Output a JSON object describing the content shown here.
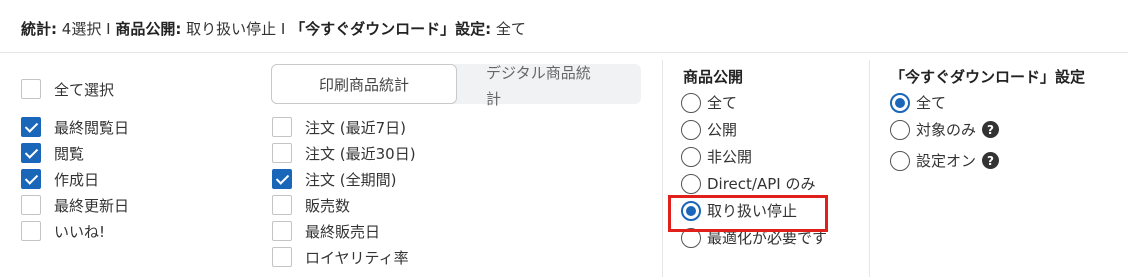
{
  "summary": {
    "stats_label": "統計:",
    "stats_value": "4選択",
    "sep": "I",
    "publish_label": "商品公開:",
    "publish_value": "取り扱い停止",
    "download_label": "「今すぐダウンロード」設定:",
    "download_value": "全て"
  },
  "select_all": {
    "label": "全て選択",
    "checked": false
  },
  "left_checkboxes": [
    {
      "label": "最終閲覧日",
      "checked": true
    },
    {
      "label": "閲覧",
      "checked": true
    },
    {
      "label": "作成日",
      "checked": true
    },
    {
      "label": "最終更新日",
      "checked": false
    },
    {
      "label": "いいね!",
      "checked": false
    }
  ],
  "tabs": {
    "print": "印刷商品統計",
    "digital_line1": "デジタル商品統",
    "digital_line2": "計"
  },
  "mid_checkboxes": [
    {
      "label": "注文 (最近7日)",
      "checked": false
    },
    {
      "label": "注文 (最近30日)",
      "checked": false
    },
    {
      "label": "注文 (全期間)",
      "checked": true
    },
    {
      "label": "販売数",
      "checked": false
    },
    {
      "label": "最終販売日",
      "checked": false
    },
    {
      "label": "ロイヤリティ率",
      "checked": false
    }
  ],
  "publish_group": {
    "title": "商品公開",
    "options": [
      {
        "label": "全て",
        "checked": false
      },
      {
        "label": "公開",
        "checked": false
      },
      {
        "label": "非公開",
        "checked": false
      },
      {
        "label": "Direct/API のみ",
        "checked": false
      },
      {
        "label": "取り扱い停止",
        "checked": true
      },
      {
        "label": "最適化が必要です",
        "checked": false
      }
    ]
  },
  "download_group": {
    "title": "「今すぐダウンロード」設定",
    "options": [
      {
        "label": "全て",
        "checked": true,
        "help": false
      },
      {
        "label": "対象のみ",
        "checked": false,
        "help": true
      },
      {
        "label": "設定オン",
        "checked": false,
        "help": true
      }
    ],
    "help_glyph": "?"
  },
  "colors": {
    "accent": "#1a66b8",
    "highlight": "#e0201b"
  }
}
